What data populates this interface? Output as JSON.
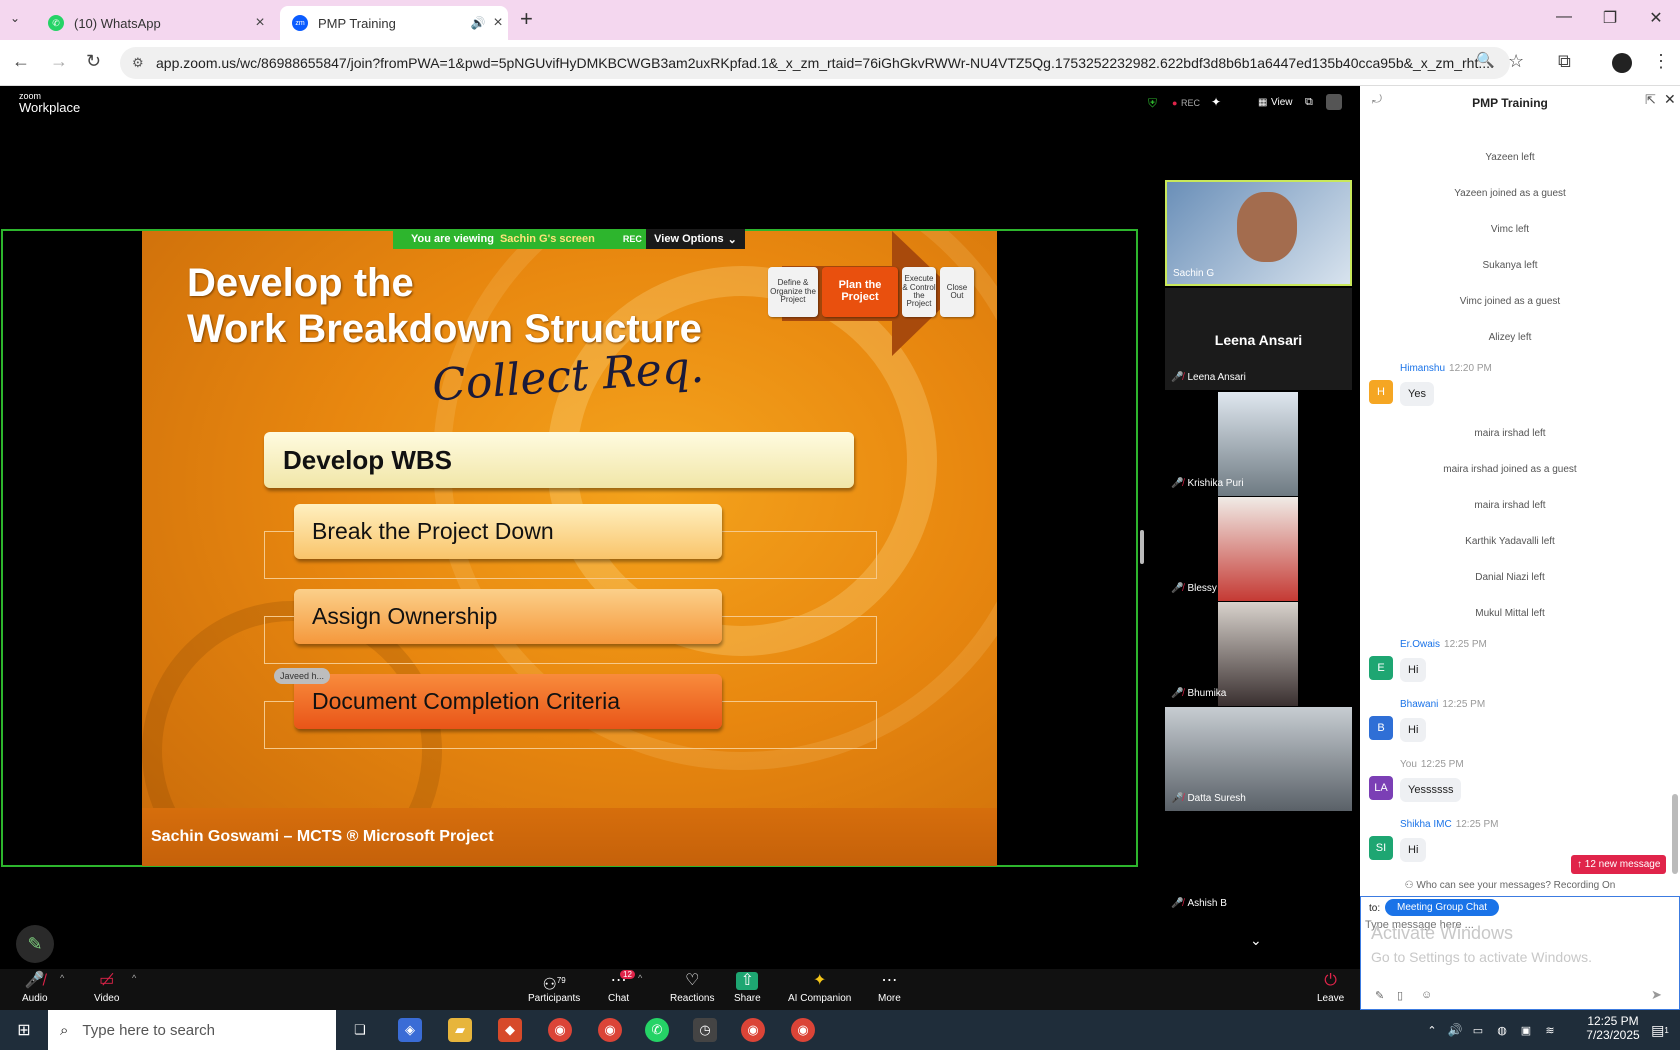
{
  "browser": {
    "tabs": [
      {
        "label": "(10) WhatsApp"
      },
      {
        "label": "PMP Training"
      }
    ],
    "new_tab": "+",
    "url": "app.zoom.us/wc/86988655847/join?fromPWA=1&pwd=5pNGUvifHyDMKBCWGB3am2uxRKpfad.1&_x_zm_rtaid=76iGhGkvRWWr-NU4VTZ5Qg.1753252232982.622bdf3d8b6b1a6447ed135b40cca95b&_x_zm_rht..."
  },
  "zoom": {
    "brand_top": "zoom",
    "brand_bottom": "Workplace",
    "rec": "REC",
    "view": "View",
    "share_banner": {
      "viewing": "You are viewing",
      "who": "Sachin G's screen",
      "rec": "REC",
      "view_options": "View Options"
    },
    "slide": {
      "title_line1": "Develop the",
      "title_line2": "Work Breakdown Structure",
      "handwriting": "Collect Req.",
      "steps": [
        "Define & Organize the Project",
        "Plan the Project",
        "Execute & Control the Project",
        "Close Out"
      ],
      "main_box": "Develop WBS",
      "items": [
        "Break the Project Down",
        "Assign Ownership",
        "Document  Completion Criteria"
      ],
      "footer": "Sachin Goswami – MCTS ® Microsoft Project",
      "cursor_label": "Javeed h..."
    },
    "participants": [
      {
        "name": "Sachin G"
      },
      {
        "name": "Leena Ansari",
        "display": "Leena Ansari"
      },
      {
        "name": "Krishika Puri"
      },
      {
        "name": "Blessy"
      },
      {
        "name": "Bhumika"
      },
      {
        "name": "Datta Suresh"
      },
      {
        "name": "Ashish B"
      }
    ],
    "controls": {
      "audio": "Audio",
      "video": "Video",
      "participants": "Participants",
      "participants_count": "79",
      "chat": "Chat",
      "chat_badge": "12",
      "reactions": "Reactions",
      "share": "Share",
      "ai": "AI Companion",
      "more": "More",
      "leave": "Leave"
    }
  },
  "chat": {
    "title": "PMP Training",
    "system": [
      "Yazeen left",
      "Yazeen joined as a guest",
      "Vimc left",
      "Sukanya left",
      "Vimc joined as a guest",
      "Alizey left",
      "maira irshad left",
      "maira irshad joined as a guest",
      "maira irshad left",
      "Karthik Yadavalli left",
      "Danial Niazi left",
      "Mukul Mittal left"
    ],
    "messages": [
      {
        "initials": "H",
        "name": "Himanshu",
        "time": "12:20 PM",
        "text": "Yes",
        "color": "#f5a623"
      },
      {
        "initials": "E",
        "name": "Er.Owais",
        "time": "12:25 PM",
        "text": "Hi",
        "color": "#1ea672"
      },
      {
        "initials": "B",
        "name": "Bhawani",
        "time": "12:25 PM",
        "text": "Hi",
        "color": "#2f6fd6"
      },
      {
        "initials": "LA",
        "name": "You",
        "time": "12:25 PM",
        "text": "Yessssss",
        "color": "#7b3fb5"
      },
      {
        "initials": "SI",
        "name": "Shikha IMC",
        "time": "12:25 PM",
        "text": "Hi",
        "color": "#1ea672"
      }
    ],
    "new_messages": "↑ 12 new message",
    "privacy": "Who can see your messages? Recording On",
    "to_label": "to:",
    "recipient": "Meeting Group Chat",
    "placeholder": "Type message here ...",
    "watermark_title": "Activate Windows",
    "watermark_sub": "Go to Settings to activate Windows."
  },
  "taskbar": {
    "search_placeholder": "Type here to search",
    "time": "12:25 PM",
    "date": "7/23/2025",
    "notif_count": "1"
  }
}
